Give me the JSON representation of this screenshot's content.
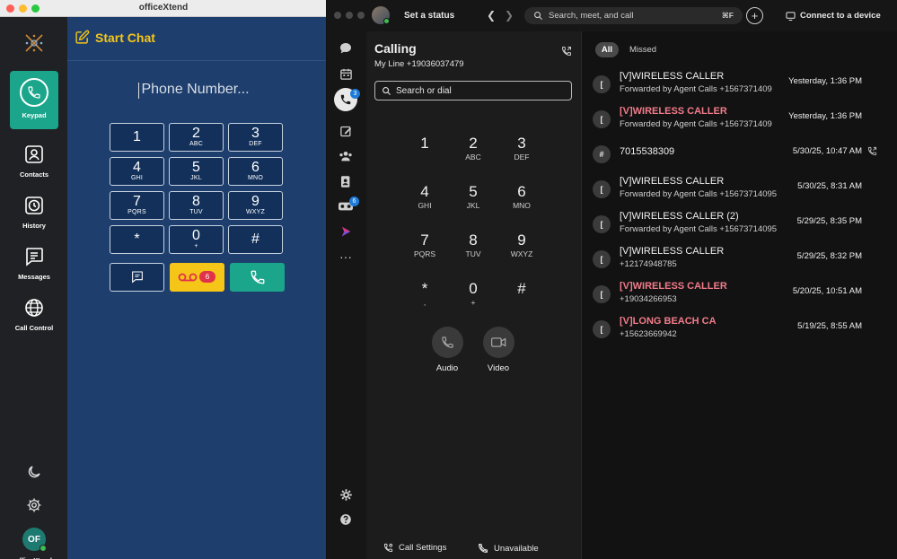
{
  "officextend": {
    "window_title": "officeXtend",
    "start_chat": "Start Chat",
    "phone_placeholder": "Phone Number...",
    "rail": [
      {
        "label": "Keypad",
        "icon": "phone-icon"
      },
      {
        "label": "Contacts",
        "icon": "contact-card-icon"
      },
      {
        "label": "History",
        "icon": "clock-icon"
      },
      {
        "label": "Messages",
        "icon": "message-icon"
      },
      {
        "label": "Call Control",
        "icon": "globe-icon"
      }
    ],
    "keys": [
      {
        "digit": "1",
        "letters": ""
      },
      {
        "digit": "2",
        "letters": "ABC"
      },
      {
        "digit": "3",
        "letters": "DEF"
      },
      {
        "digit": "4",
        "letters": "GHI"
      },
      {
        "digit": "5",
        "letters": "JKL"
      },
      {
        "digit": "6",
        "letters": "MNO"
      },
      {
        "digit": "7",
        "letters": "PQRS"
      },
      {
        "digit": "8",
        "letters": "TUV"
      },
      {
        "digit": "9",
        "letters": "WXYZ"
      },
      {
        "digit": "*",
        "letters": ""
      },
      {
        "digit": "0",
        "letters": "+"
      },
      {
        "digit": "#",
        "letters": ""
      }
    ],
    "voicemail_count": "6",
    "avatar_initials": "OF",
    "avatar_label": "officeXtend",
    "colors": {
      "accent": "#f5c518",
      "panel": "#1e3f6e",
      "call": "#1ba58a"
    }
  },
  "webex": {
    "status": "Set a status",
    "search_placeholder": "Search, meet, and call",
    "search_shortcut": "⌘F",
    "connect_device": "Connect to a device",
    "calls_badge": "3",
    "voicemail_badge": "6",
    "calling_title": "Calling",
    "my_line": "My Line +19036037479",
    "dial_placeholder": "Search or dial",
    "keys": [
      {
        "digit": "1",
        "letters": ""
      },
      {
        "digit": "2",
        "letters": "ABC"
      },
      {
        "digit": "3",
        "letters": "DEF"
      },
      {
        "digit": "4",
        "letters": "GHI"
      },
      {
        "digit": "5",
        "letters": "JKL"
      },
      {
        "digit": "6",
        "letters": "MNO"
      },
      {
        "digit": "7",
        "letters": "PQRS"
      },
      {
        "digit": "8",
        "letters": "TUV"
      },
      {
        "digit": "9",
        "letters": "WXYZ"
      },
      {
        "digit": "*",
        "letters": ","
      },
      {
        "digit": "0",
        "letters": "+"
      },
      {
        "digit": "#",
        "letters": ""
      }
    ],
    "audio_label": "Audio",
    "video_label": "Video",
    "call_settings": "Call Settings",
    "unavailable": "Unavailable",
    "tabs": {
      "all": "All",
      "missed": "Missed"
    },
    "history": [
      {
        "avatar": "[",
        "name": "[V]WIRELESS CALLER",
        "sub": "Forwarded by Agent Calls +1567371409",
        "time": "Yesterday, 1:36 PM",
        "missed": false
      },
      {
        "avatar": "[",
        "name": "[V]WIRELESS CALLER",
        "sub": "Forwarded by Agent Calls +1567371409",
        "time": "Yesterday, 1:36 PM",
        "missed": true
      },
      {
        "avatar": "#",
        "name": "7015538309",
        "sub": "",
        "time": "5/30/25, 10:47 AM",
        "missed": false
      },
      {
        "avatar": "[",
        "name": "[V]WIRELESS CALLER",
        "sub": "Forwarded by Agent Calls +15673714095",
        "time": "5/30/25, 8:31 AM",
        "missed": false
      },
      {
        "avatar": "[",
        "name": "[V]WIRELESS CALLER (2)",
        "sub": "Forwarded by Agent Calls +15673714095",
        "time": "5/29/25, 8:35 PM",
        "missed": false
      },
      {
        "avatar": "[",
        "name": "[V]WIRELESS CALLER",
        "sub": "+12174948785",
        "time": "5/29/25, 8:32 PM",
        "missed": false
      },
      {
        "avatar": "[",
        "name": "[V]WIRELESS CALLER",
        "sub": "+19034266953",
        "time": "5/20/25, 10:51 AM",
        "missed": true
      },
      {
        "avatar": "[",
        "name": "[V]LONG BEACH   CA",
        "sub": "+15623669942",
        "time": "5/19/25, 8:55 AM",
        "missed": true
      }
    ]
  }
}
